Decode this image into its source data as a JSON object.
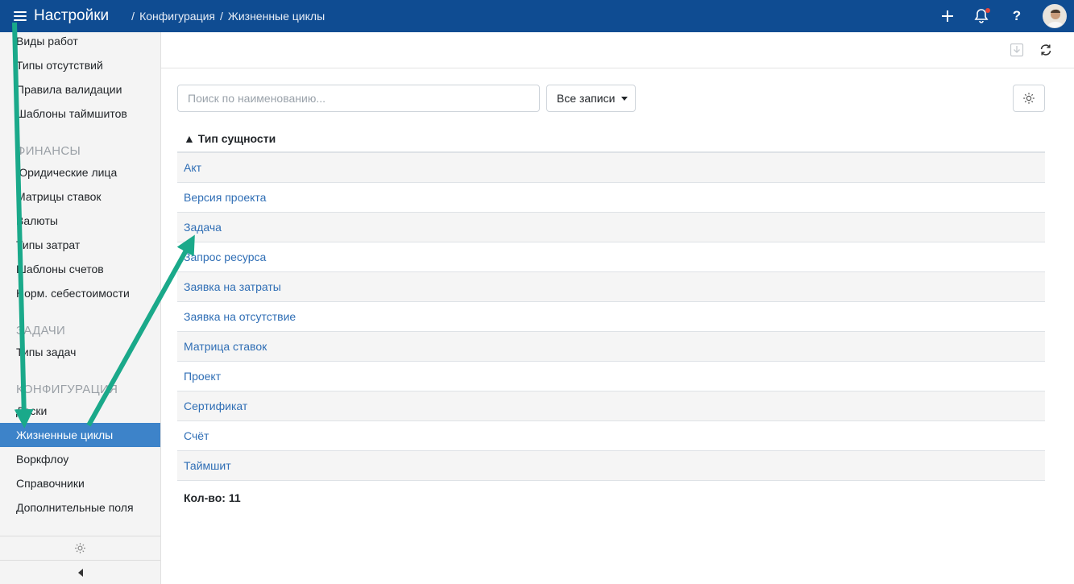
{
  "header": {
    "app_title": "Настройки",
    "breadcrumbs": [
      "Конфигурация",
      "Жизненные циклы"
    ],
    "icons": [
      "menu-icon",
      "plus-icon",
      "bell-icon",
      "help-icon",
      "avatar"
    ],
    "help_label": "?"
  },
  "sidebar": {
    "items_top": [
      "Виды работ",
      "Типы отсутствий",
      "Правила валидации",
      "Шаблоны таймшитов"
    ],
    "group_finance": "ФИНАНСЫ",
    "items_finance": [
      "Юридические лица",
      "Матрицы ставок",
      "Валюты",
      "Типы затрат",
      "Шаблоны счетов",
      "Норм. себестоимости"
    ],
    "group_tasks": "ЗАДАЧИ",
    "items_tasks": [
      "Типы задач"
    ],
    "group_config": "КОНФИГУРАЦИЯ",
    "items_config": [
      "Доски",
      "Жизненные циклы",
      "Воркфлоу",
      "Справочники",
      "Дополнительные поля"
    ],
    "active_item": "Жизненные циклы"
  },
  "toolbar": {
    "icons": [
      "download-icon",
      "refresh-icon"
    ]
  },
  "filters": {
    "search_placeholder": "Поиск по наименованию...",
    "dropdown_value": "Все записи"
  },
  "table": {
    "header": "▲ Тип сущности",
    "rows": [
      "Акт",
      "Версия проекта",
      "Задача",
      "Запрос ресурса",
      "Заявка на затраты",
      "Заявка на отсутствие",
      "Матрица ставок",
      "Проект",
      "Сертификат",
      "Счёт",
      "Таймшит"
    ]
  },
  "footer": {
    "count_label": "Кол-во: 11"
  },
  "colors": {
    "topbar": "#0f4c92",
    "active_item": "#3d83c9",
    "link": "#2f6eb5",
    "annotation_arrow": "#1aa98a"
  }
}
